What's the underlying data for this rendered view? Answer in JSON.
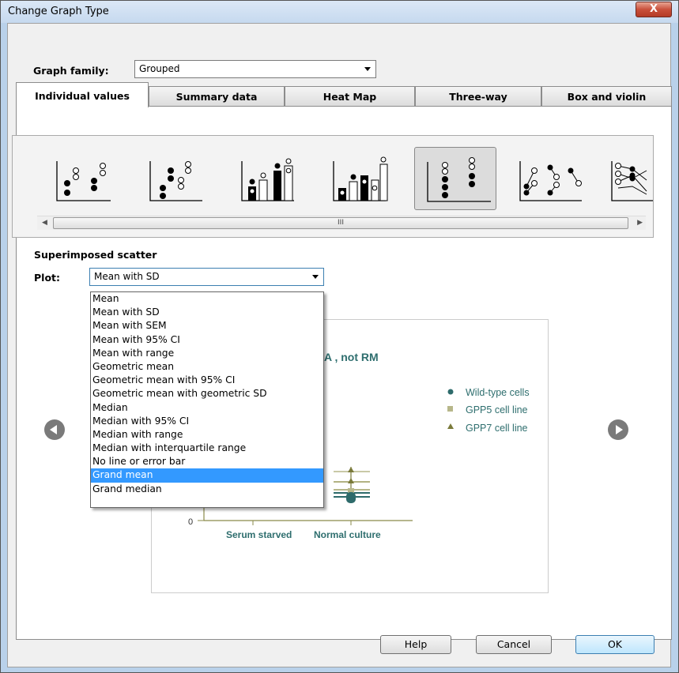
{
  "window": {
    "title": "Change Graph Type",
    "close_label": "X"
  },
  "graph_family": {
    "label": "Graph family:",
    "value": "Grouped"
  },
  "tabs": [
    {
      "label": "Individual values",
      "active": true
    },
    {
      "label": "Summary data",
      "active": false
    },
    {
      "label": "Heat Map",
      "active": false
    },
    {
      "label": "Three-way",
      "active": false
    },
    {
      "label": "Box and violin",
      "active": false
    }
  ],
  "gallery": {
    "selected_index": 4,
    "thumbnails": [
      "scatter-interleaved",
      "scatter-separated",
      "bars-with-points-a",
      "bars-with-points-b",
      "superimposed-scatter",
      "before-after-pairs",
      "line-connected"
    ],
    "scroll_marker": "III"
  },
  "section_title": "Superimposed scatter",
  "plot": {
    "label": "Plot:",
    "value": "Mean with SD",
    "options": [
      "Mean",
      "Mean with SD",
      "Mean with SEM",
      "Mean with 95% CI",
      "Mean with range",
      "Geometric mean",
      "Geometric mean with 95% CI",
      "Geometric mean with geometric SD",
      "Median",
      "Median with 95% CI",
      "Median with range",
      "Median with interquartile range",
      "No line or error bar",
      "Grand mean",
      "Grand median"
    ],
    "highlighted": "Grand mean"
  },
  "preview": {
    "title_fragment": "A , not RM",
    "legend": [
      {
        "name": "Wild-type cells",
        "marker": "circle"
      },
      {
        "name": "GPP5 cell line",
        "marker": "square"
      },
      {
        "name": "GPP7 cell line",
        "marker": "triangle"
      }
    ],
    "x_categories": [
      "Serum starved",
      "Normal culture"
    ],
    "y_tick": "0",
    "colors": {
      "series": "#2e6b6b",
      "square": "#b7b78a",
      "triangle": "#7a7a3a",
      "axis": "#8a8a4a",
      "text": "#2e6e6e"
    }
  },
  "buttons": {
    "help": "Help",
    "cancel": "Cancel",
    "ok": "OK"
  }
}
